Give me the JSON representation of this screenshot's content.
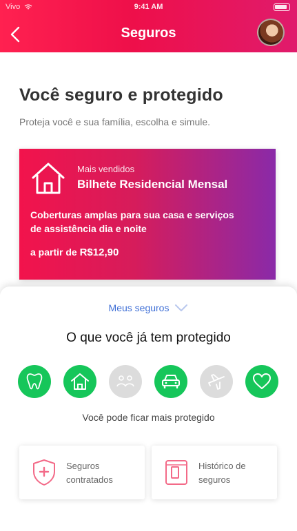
{
  "status_bar": {
    "carrier": "Vivo",
    "time": "9:41 AM"
  },
  "header": {
    "title": "Seguros"
  },
  "intro": {
    "heading": "Você seguro e protegido",
    "subheading": "Proteja você e sua família, escolha e simule."
  },
  "promo": {
    "kicker": "Mais vendidos",
    "name": "Bilhete Residencial Mensal",
    "description": "Coberturas amplas para sua casa e serviços de assistência dia e noite",
    "price_prefix": "a partir de",
    "price": "R$12,90"
  },
  "sheet": {
    "toggle_label": "Meus seguros",
    "protected_title": "O que você já tem protegido",
    "coverage_icons": [
      {
        "icon": "tooth-icon",
        "active": true
      },
      {
        "icon": "house-icon",
        "active": true
      },
      {
        "icon": "people-icon",
        "active": false
      },
      {
        "icon": "car-icon",
        "active": true
      },
      {
        "icon": "airplane-icon",
        "active": false
      },
      {
        "icon": "heart-icon",
        "active": true
      }
    ],
    "more_protection_text": "Você pode ficar mais protegido",
    "cards": [
      {
        "label": "Seguros contratados",
        "icon": "shield-icon"
      },
      {
        "label": "Histórico de seguros",
        "icon": "history-icon"
      }
    ]
  },
  "colors": {
    "header_red": "#ee0f4a",
    "promo_purple": "#8a2aa8",
    "active_green": "#16c65a",
    "inactive_gray": "#dcdcdc",
    "link_blue": "#3f6fd6"
  }
}
